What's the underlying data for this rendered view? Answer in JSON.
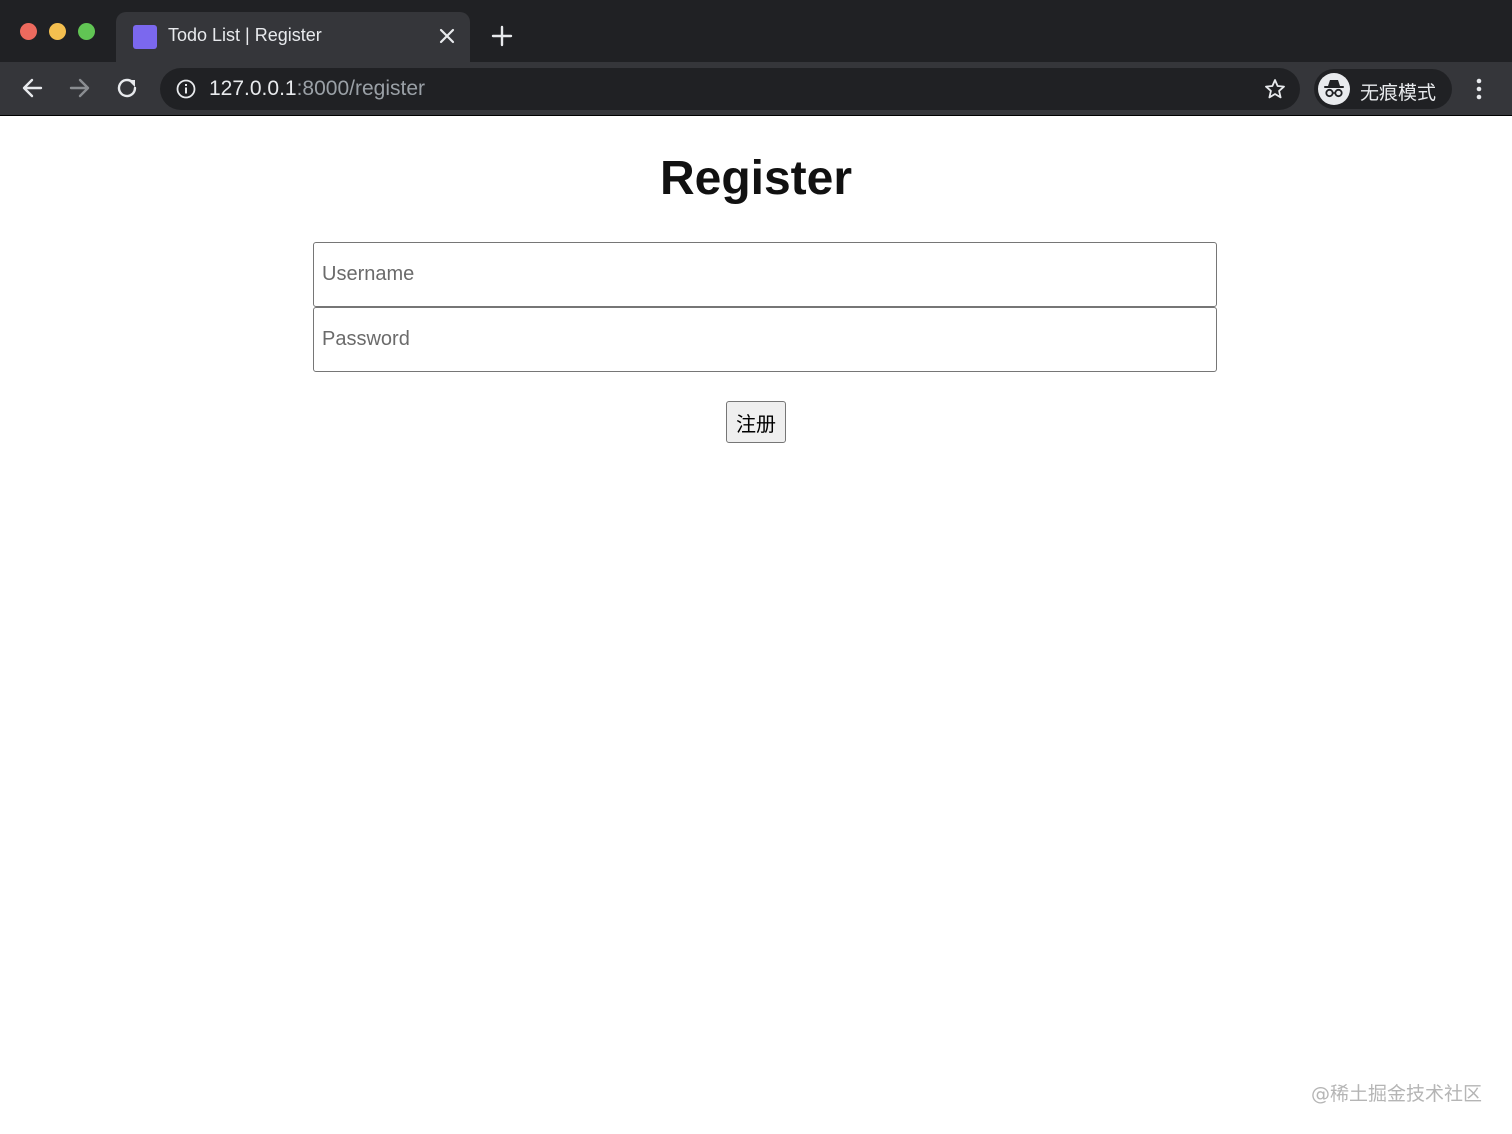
{
  "browser": {
    "tab": {
      "title": "Todo List | Register",
      "favicon_color": "#7b68ee"
    },
    "url": {
      "host": "127.0.0.1",
      "rest": ":8000/register"
    },
    "incognito_label": "无痕模式"
  },
  "page": {
    "title": "Register",
    "username": {
      "placeholder": "Username",
      "value": ""
    },
    "password": {
      "placeholder": "Password",
      "value": ""
    },
    "submit_label": "注册",
    "watermark": "@稀土掘金技术社区"
  }
}
